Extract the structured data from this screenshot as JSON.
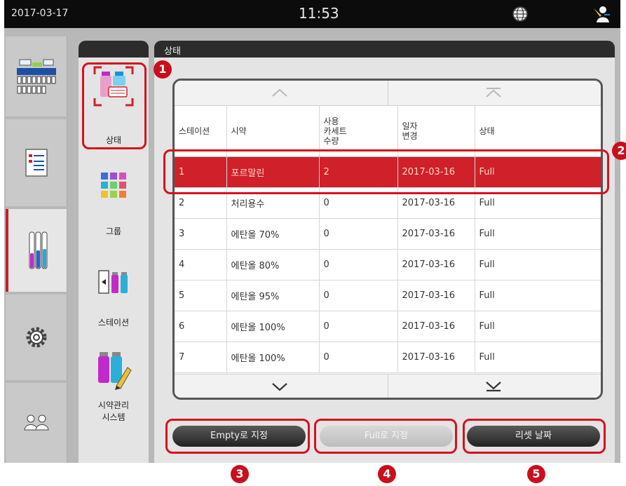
{
  "topbar": {
    "date": "2017-03-17",
    "time": "11:53",
    "globe_icon": "globe-icon",
    "user_icon": "user-icon"
  },
  "nav": {
    "items": [
      {
        "icon": "program-grid-icon"
      },
      {
        "icon": "document-list-icon"
      },
      {
        "icon": "reagent-tubes-icon",
        "active": true
      },
      {
        "icon": "gear-icon"
      },
      {
        "icon": "users-icon"
      }
    ]
  },
  "submenu": {
    "items": [
      {
        "label": "상태",
        "icon": "reagent-status-icon",
        "active": true
      },
      {
        "label": "그룹",
        "icon": "color-grid-icon"
      },
      {
        "label": "스테이션",
        "icon": "station-icon"
      },
      {
        "label": "시약관리\n시스템",
        "icon": "reagent-edit-icon"
      }
    ]
  },
  "content": {
    "title": "상태",
    "columns": [
      "스테이션",
      "시약",
      "사용\n카세트\n수량",
      "일자\n변경",
      "상태"
    ],
    "rows": [
      [
        "1",
        "포르말린",
        "2",
        "2017-03-16",
        "Full"
      ],
      [
        "2",
        "처리용수",
        "0",
        "2017-03-16",
        "Full"
      ],
      [
        "3",
        "에탄올 70%",
        "0",
        "2017-03-16",
        "Full"
      ],
      [
        "4",
        "에탄올 80%",
        "0",
        "2017-03-16",
        "Full"
      ],
      [
        "5",
        "에탄올 95%",
        "0",
        "2017-03-16",
        "Full"
      ],
      [
        "6",
        "에탄올 100%",
        "0",
        "2017-03-16",
        "Full"
      ],
      [
        "7",
        "에탄올 100%",
        "0",
        "2017-03-16",
        "Full"
      ]
    ],
    "selected_row_index": 0
  },
  "buttons": {
    "set_empty": "Empty로 지정",
    "set_full": "Full로 지정",
    "reset_date": "리셋 날짜"
  },
  "markers": [
    "1",
    "2",
    "3",
    "4",
    "5"
  ],
  "colors": {
    "accent_red": "#c8101c",
    "selected_row": "#d0202a",
    "header_dark": "#2c2c2c"
  }
}
